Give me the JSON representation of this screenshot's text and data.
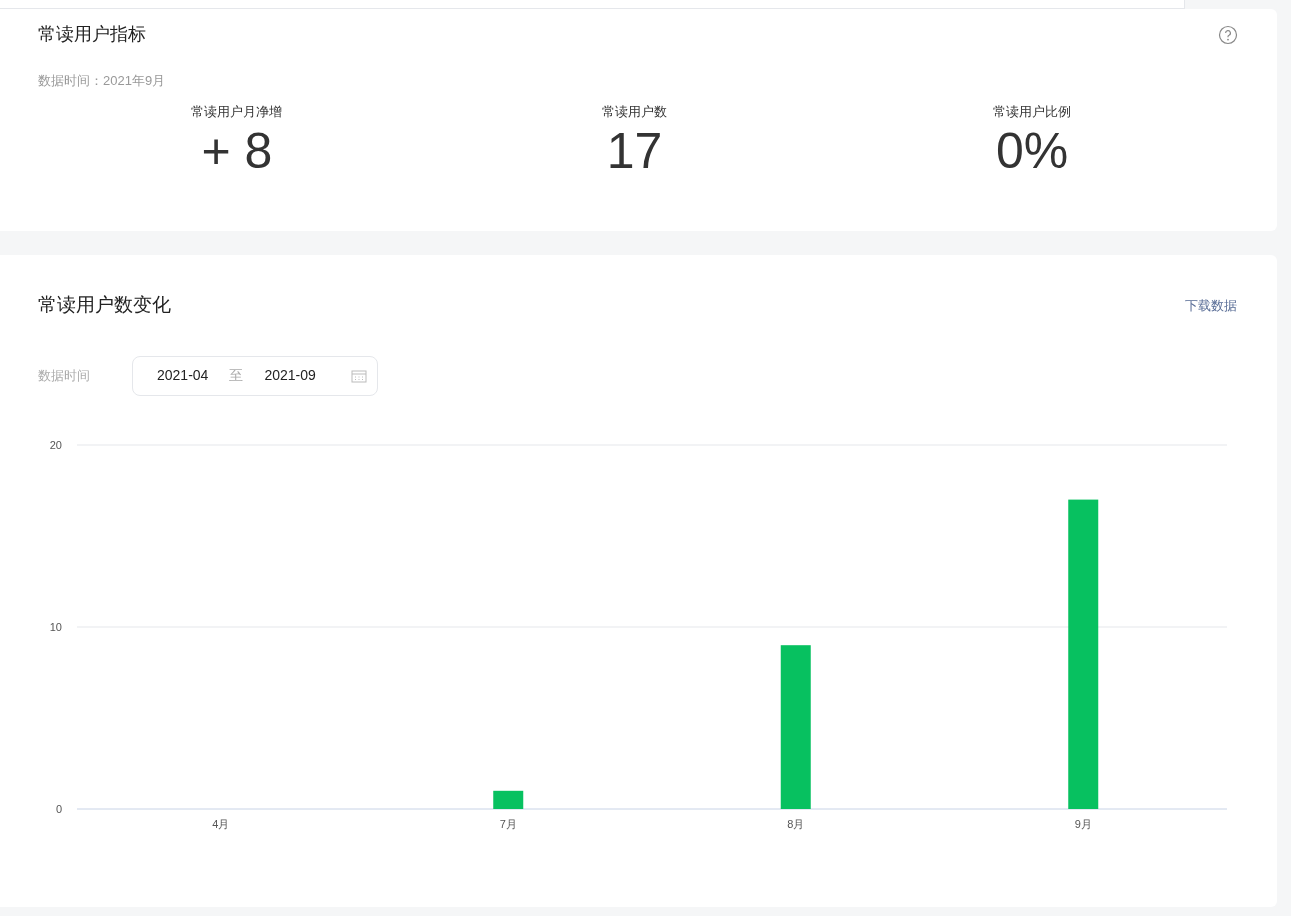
{
  "metrics_card": {
    "title": "常读用户指标",
    "data_time": "数据时间：2021年9月",
    "metrics": [
      {
        "label": "常读用户月净增",
        "value": "+ 8"
      },
      {
        "label": "常读用户数",
        "value": "17"
      },
      {
        "label": "常读用户比例",
        "value": "0%"
      }
    ]
  },
  "trend_card": {
    "title": "常读用户数变化",
    "download_link": "下载数据",
    "date_label": "数据时间",
    "date_from": "2021-04",
    "date_separator": "至",
    "date_to": "2021-09",
    "chart_data": {
      "type": "bar",
      "categories": [
        "4月",
        "7月",
        "8月",
        "9月"
      ],
      "series": [
        {
          "color": "#07c160",
          "values": [
            0,
            1,
            9,
            17
          ]
        }
      ],
      "ylim": [
        0,
        20
      ],
      "yticks": [
        0,
        10,
        20
      ]
    }
  }
}
